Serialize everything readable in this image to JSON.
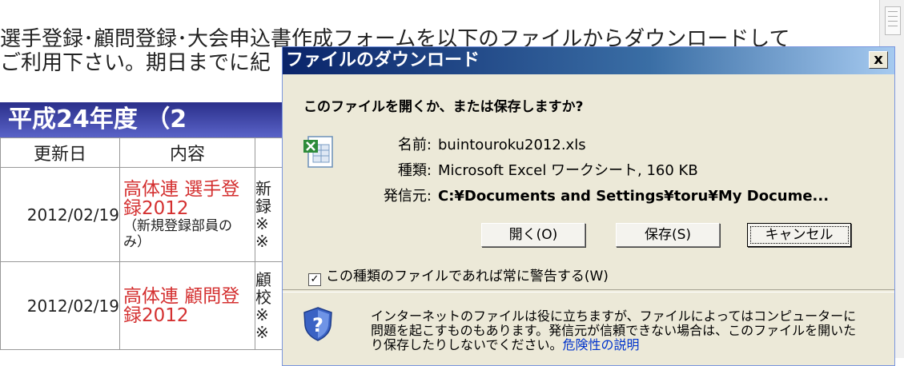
{
  "page": {
    "intro_line1": "選手登録･顧問登録･大会申込書作成フォームを以下のファイルからダウンロードして",
    "intro_line2": "ご利用下さい。期日までに紀",
    "section_title": "平成24年度 （2",
    "table": {
      "headers": [
        "更新日",
        "内容",
        ""
      ],
      "rows": [
        {
          "date": "2012/02/19",
          "link": "高体連 選手登録2012",
          "note": "（新規登録部員のみ）",
          "cut": "新\n録\n※\n※"
        },
        {
          "date": "2012/02/19",
          "link": "高体連 顧問登録2012",
          "note": "",
          "cut": "顧\n校\n※\n※"
        }
      ]
    }
  },
  "dialog": {
    "title": "ファイルのダウンロード",
    "close_label": "x",
    "question": "このファイルを開くか、または保存しますか?",
    "file": {
      "name_label": "名前:",
      "name": "buintouroku2012.xls",
      "type_label": "種類:",
      "type": "Microsoft Excel ワークシート, 160 KB",
      "from_label": "発信元:",
      "from": "C:¥Documents and Settings¥toru¥My Docume..."
    },
    "buttons": {
      "open": "開く(O)",
      "save": "保存(S)",
      "cancel": "キャンセル"
    },
    "checkbox_label": "この種類のファイルであれば常に警告する(W)",
    "checkbox_checked": "✓",
    "warning_text": "インターネットのファイルは役に立ちますが、ファイルによってはコンピューターに問題を起こすものもあります。発信元が信頼できない場合は、このファイルを開いたり保存したりしないでください。",
    "warning_link": "危険性の説明"
  },
  "icons": {
    "file": "excel-file-icon",
    "shield": "security-shield-icon",
    "close": "close-icon"
  }
}
